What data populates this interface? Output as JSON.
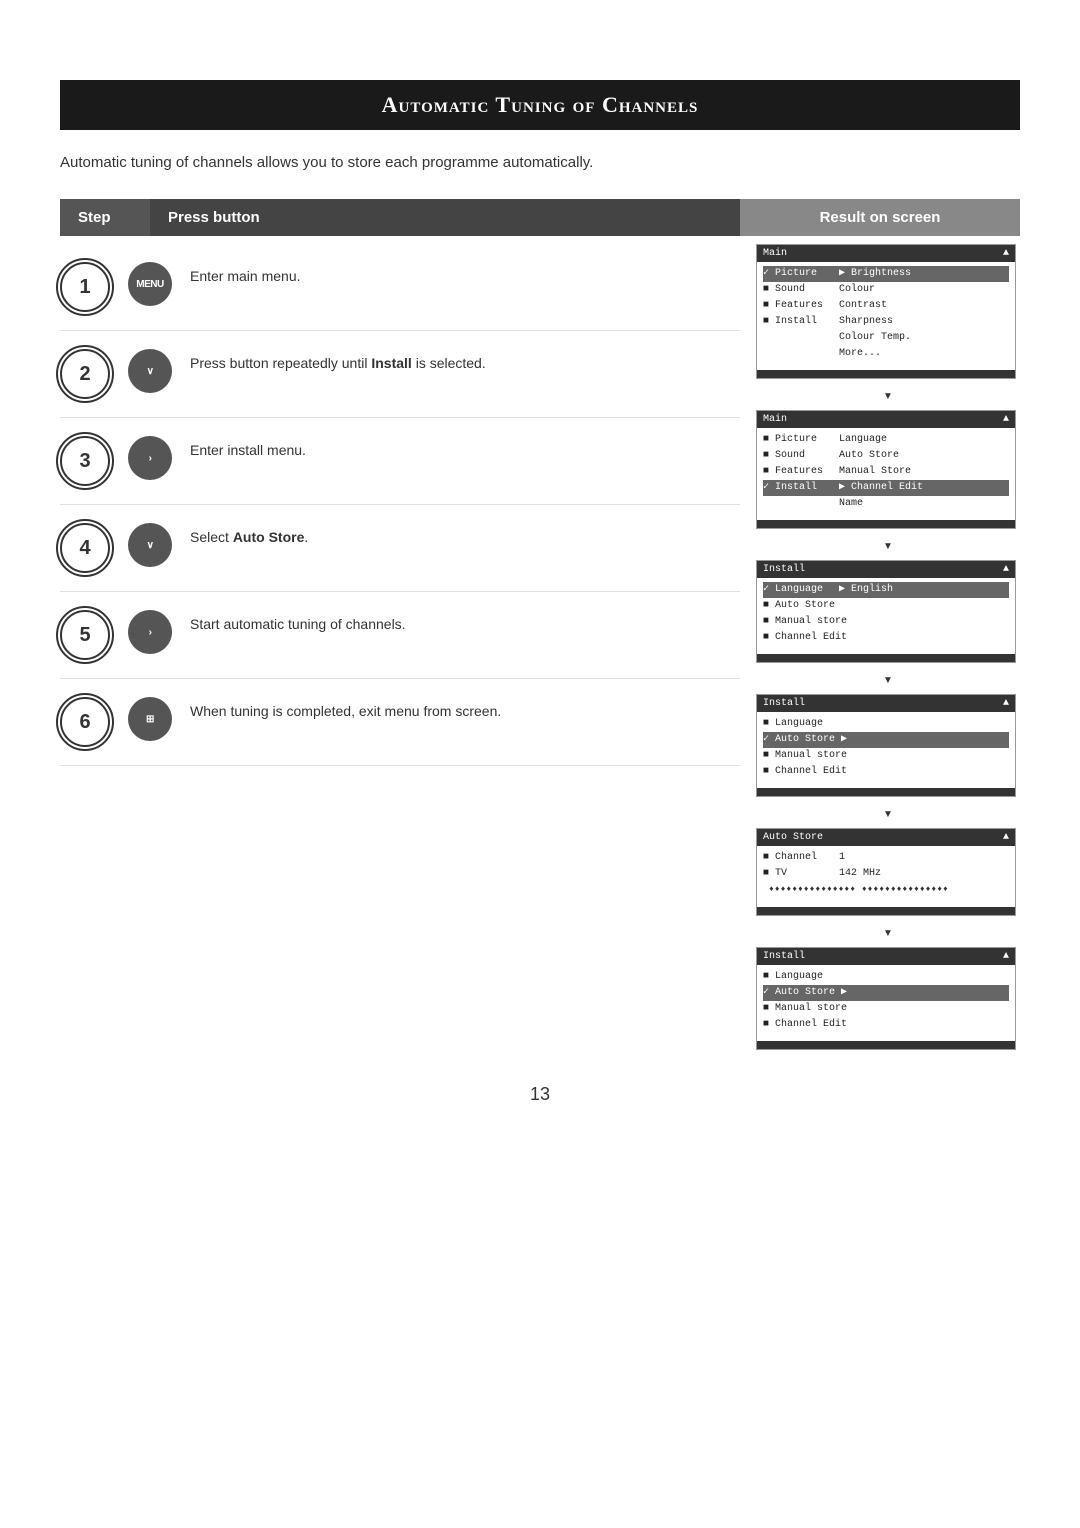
{
  "title": "Automatic Tuning of Channels",
  "subtitle": "Automatic tuning of channels allows you to store each programme automatically.",
  "headers": {
    "step": "Step",
    "press": "Press button",
    "result": "Result on screen"
  },
  "steps": [
    {
      "number": "1",
      "button": "MENU",
      "button_type": "round",
      "text": "Enter main menu.",
      "screen": {
        "header": "Main",
        "rows": [
          {
            "label": "✓ Picture",
            "value": "▶  Brightness",
            "selected": true
          },
          {
            "label": "■ Sound",
            "value": "Colour",
            "selected": false
          },
          {
            "label": "■ Features",
            "value": "Contrast",
            "selected": false
          },
          {
            "label": "■ Install",
            "value": "Sharpness",
            "selected": false
          },
          {
            "label": "",
            "value": "Colour Temp.",
            "selected": false
          },
          {
            "label": "",
            "value": "More...",
            "selected": false
          }
        ]
      }
    },
    {
      "number": "2",
      "button": "∨",
      "button_type": "round",
      "text": "Press button repeatedly until <strong>Install</strong> is selected.",
      "screen": {
        "header": "Main",
        "rows": [
          {
            "label": "■ Picture",
            "value": "Language",
            "selected": false
          },
          {
            "label": "■ Sound",
            "value": "Auto Store",
            "selected": false
          },
          {
            "label": "■ Features",
            "value": "Manual Store",
            "selected": false
          },
          {
            "label": "✓ Install",
            "value": "▶  Channel Edit",
            "selected": true
          },
          {
            "label": "",
            "value": "Name",
            "selected": false
          }
        ]
      }
    },
    {
      "number": "3",
      "button": "›",
      "button_type": "round",
      "text": "Enter install menu.",
      "screen": {
        "header": "Install",
        "rows": [
          {
            "label": "✓ Language",
            "value": "▶  English",
            "selected": true
          },
          {
            "label": "■ Auto Store",
            "value": "",
            "selected": false
          },
          {
            "label": "■ Manual store",
            "value": "",
            "selected": false
          },
          {
            "label": "■ Channel Edit",
            "value": "",
            "selected": false
          }
        ]
      }
    },
    {
      "number": "4",
      "button": "∨",
      "button_type": "round",
      "text": "Select <strong>Auto Store</strong>.",
      "screen": {
        "header": "Install",
        "rows": [
          {
            "label": "■ Language",
            "value": "",
            "selected": false
          },
          {
            "label": "✓ Auto Store",
            "value": "▶",
            "selected": true
          },
          {
            "label": "■ Manual store",
            "value": "",
            "selected": false
          },
          {
            "label": "■ Channel Edit",
            "value": "",
            "selected": false
          }
        ]
      }
    },
    {
      "number": "5",
      "button": "›",
      "button_type": "round",
      "text": "Start automatic tuning of channels.",
      "screen": {
        "header": "Auto Store",
        "rows": [
          {
            "label": "■ Channel",
            "value": "1",
            "selected": false
          },
          {
            "label": "■ TV",
            "value": "142 MHz",
            "selected": false
          }
        ],
        "progress": true
      }
    },
    {
      "number": "6",
      "button": "⊞",
      "button_type": "round",
      "text": "When tuning is completed, exit menu from screen.",
      "screen": {
        "header": "Install",
        "rows": [
          {
            "label": "■ Language",
            "value": "",
            "selected": false
          },
          {
            "label": "✓ Auto Store",
            "value": "▶",
            "selected": true
          },
          {
            "label": "■ Manual store",
            "value": "",
            "selected": false
          },
          {
            "label": "■ Channel Edit",
            "value": "",
            "selected": false
          }
        ]
      }
    }
  ],
  "page_number": "13"
}
